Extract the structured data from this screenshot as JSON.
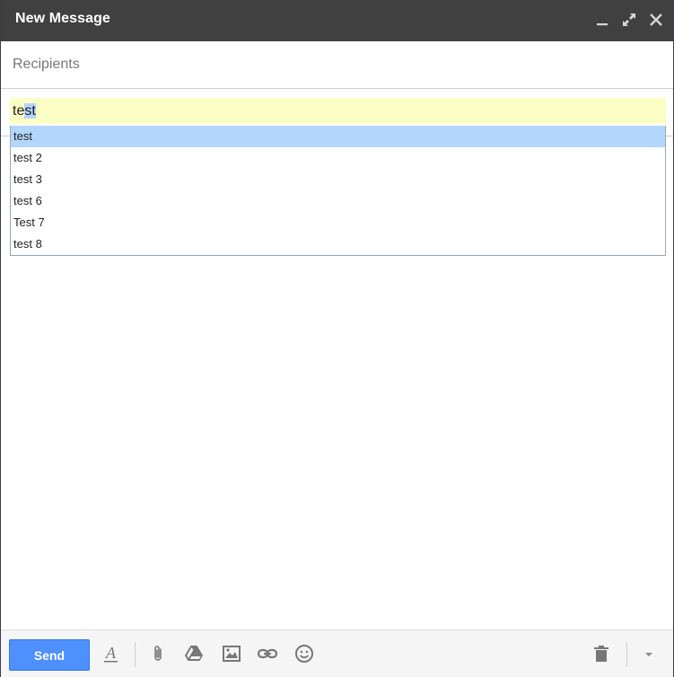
{
  "window": {
    "title": "New Message"
  },
  "titlebar_icons": [
    "minimize-icon",
    "expand-icon",
    "close-icon"
  ],
  "recipients": {
    "label": "Recipients"
  },
  "subject": {
    "value_unselected": "te",
    "value_selected": "st"
  },
  "autocomplete": {
    "items": [
      "test",
      "test 2",
      "test 3",
      "test 6",
      "Test 7",
      "test 8"
    ],
    "active_index": 0
  },
  "toolbar": {
    "send_label": "Send",
    "icons": [
      "formatting-icon",
      "attach-icon",
      "drive-icon",
      "photo-icon",
      "link-icon",
      "emoji-icon",
      "trash-icon",
      "more-options-icon"
    ]
  },
  "colors": {
    "titlebar": "#404040",
    "send_button": "#4d90fe",
    "subject_highlight": "#fbffc6",
    "autocomplete_active": "#b3d7fb",
    "text_selection": "#b3d4fc"
  }
}
